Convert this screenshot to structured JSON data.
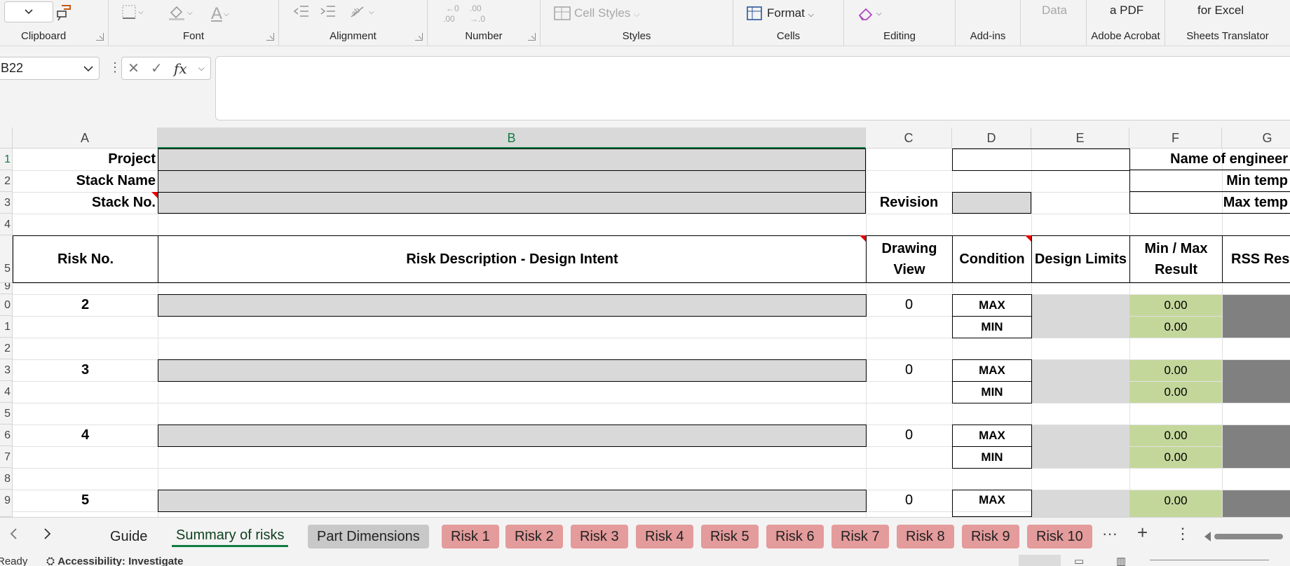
{
  "ribbon": {
    "groups": {
      "clipboard": "Clipboard",
      "font": "Font",
      "alignment": "Alignment",
      "number": "Number",
      "styles": "Styles",
      "cells": "Cells",
      "editing": "Editing",
      "addins": "Add-ins",
      "adobe": "Adobe Acrobat",
      "translator": "Sheets Translator"
    },
    "cell_styles_label": "Cell Styles",
    "format_label": "Format",
    "data_label": "Data",
    "pdf_label": "a PDF",
    "excel_label": "for Excel",
    "icons": [
      "paste-dropdown-icon",
      "format-painter-icon",
      "borders-icon",
      "fill-color-icon",
      "font-color-icon",
      "decrease-indent-icon",
      "increase-indent-icon",
      "orientation-icon",
      "decrease-decimal-icon",
      "increase-decimal-icon",
      "cell-styles-icon",
      "format-cells-icon",
      "eraser-icon"
    ]
  },
  "formula_bar": {
    "name_box": "B22",
    "formula": ""
  },
  "grid": {
    "columns": [
      "A",
      "B",
      "C",
      "D",
      "E",
      "F",
      "G"
    ],
    "selected_column": "B",
    "row_numbers": [
      "1",
      "2",
      "3",
      "4",
      "5",
      "9",
      "0",
      "1",
      "2",
      "3",
      "4",
      "5",
      "6",
      "7",
      "8",
      "9"
    ],
    "header_labels": {
      "project": "Project",
      "stack_name": "Stack Name",
      "stack_no": "Stack No.",
      "revision": "Revision",
      "engineer": "Name of engineer",
      "min_temp": "Min temp",
      "max_temp": "Max temp"
    },
    "table_headers": {
      "risk_no": "Risk No.",
      "risk_desc": "Risk Description - Design Intent",
      "drawing_view": "Drawing View",
      "condition": "Condition",
      "design_limits": "Design Limits",
      "minmax_result": "Min / Max Result",
      "rss_result": "RSS Resu"
    },
    "risks": [
      {
        "no": "2",
        "view": "0",
        "max": "MAX",
        "min": "MIN",
        "max_result": "0.00",
        "min_result": "0.00"
      },
      {
        "no": "3",
        "view": "0",
        "max": "MAX",
        "min": "MIN",
        "max_result": "0.00",
        "min_result": "0.00"
      },
      {
        "no": "4",
        "view": "0",
        "max": "MAX",
        "min": "MIN",
        "max_result": "0.00",
        "min_result": "0.00"
      },
      {
        "no": "5",
        "view": "0",
        "max": "MAX"
      }
    ],
    "colors": {
      "gray_fill": "#d9d9d9",
      "green_fill": "#c4d79b",
      "dark_fill": "#808080",
      "comment_marker": "#e00000"
    }
  },
  "sheet_tabs": {
    "tabs": [
      "Guide",
      "Summary of risks",
      "Part Dimensions",
      "Risk 1",
      "Risk 2",
      "Risk 3",
      "Risk 4",
      "Risk 5",
      "Risk 6",
      "Risk 7",
      "Risk 8",
      "Risk 9",
      "Risk 10"
    ],
    "active": "Summary of risks",
    "colors": {
      "risk_tab": "#e49b9b",
      "dimensions_tab": "#c8c8c8",
      "active_underline": "#107c41"
    }
  },
  "status_bar": {
    "ready": "Ready",
    "accessibility": "Accessibility: Investigate"
  }
}
